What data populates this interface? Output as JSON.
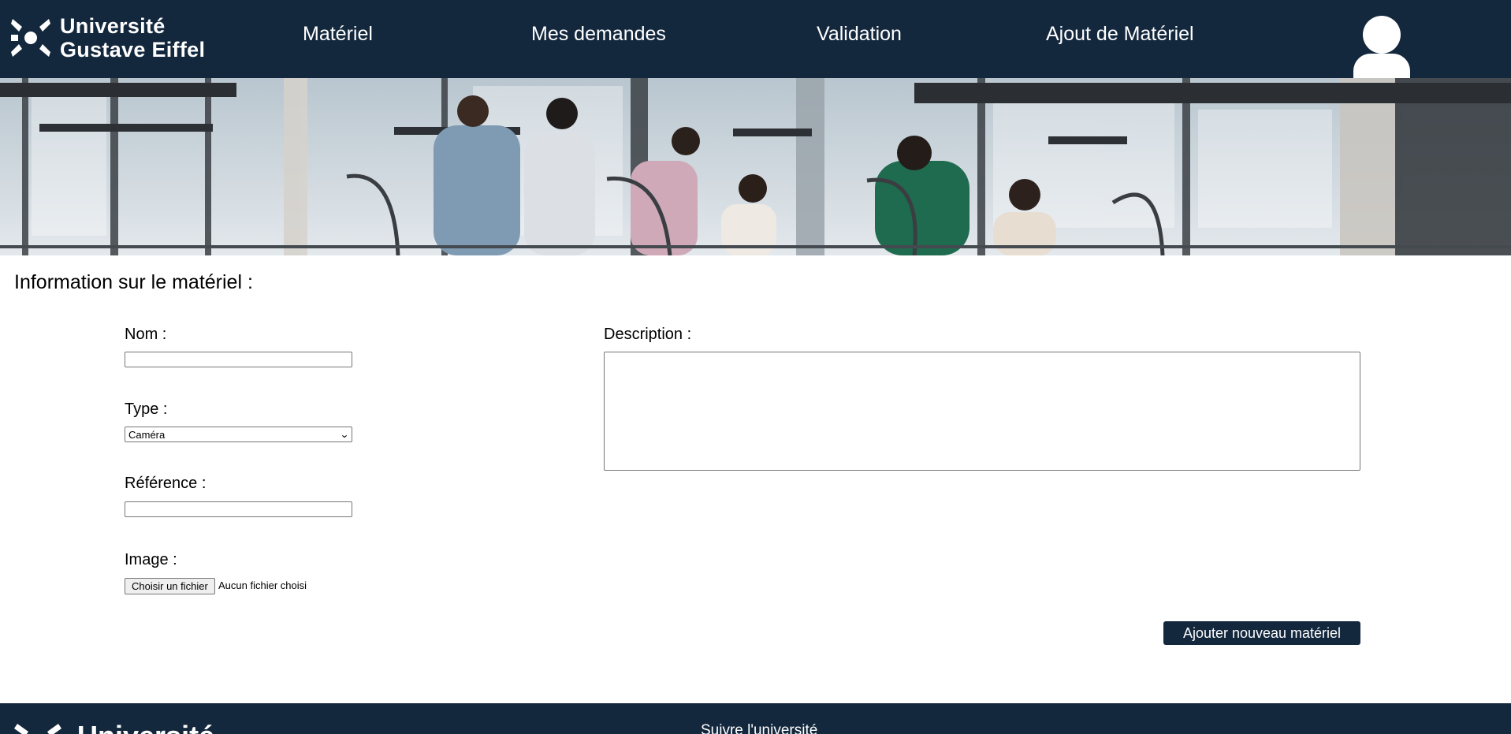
{
  "header": {
    "logo_line1": "Université",
    "logo_line2": "Gustave Eiffel",
    "nav": [
      {
        "label": "Matériel"
      },
      {
        "label": "Mes demandes"
      },
      {
        "label": "Validation"
      },
      {
        "label": "Ajout de Matériel"
      }
    ]
  },
  "form": {
    "title": "Information sur le matériel :",
    "name_label": "Nom :",
    "name_value": "",
    "type_label": "Type :",
    "type_selected": "Caméra",
    "reference_label": "Référence :",
    "reference_value": "",
    "image_label": "Image :",
    "file_button": "Choisir un fichier",
    "file_status": "Aucun fichier choisi",
    "description_label": "Description :",
    "description_value": "",
    "submit_label": "Ajouter nouveau matériel"
  },
  "footer": {
    "logo_text": "Université",
    "follow_label": "Suivre l'université"
  },
  "colors": {
    "primary": "#13273d",
    "background": "#ffffff"
  },
  "icons": {
    "logo": "university-logo-icon",
    "user": "user-avatar-icon",
    "select_arrow": "chevron-down-icon"
  }
}
